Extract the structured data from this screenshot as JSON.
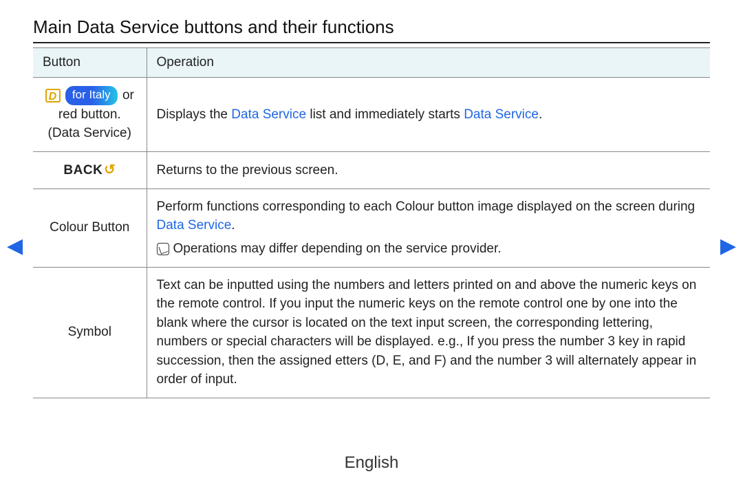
{
  "title": "Main Data Service buttons and their functions",
  "table": {
    "header": {
      "col1": "Button",
      "col2": "Operation"
    },
    "row1": {
      "button_for_italy": "for Italy",
      "button_or": " or",
      "button_line2": "red button.",
      "button_line3": "(Data Service)",
      "op_pre": "Displays the ",
      "op_link1": "Data Service",
      "op_mid": " list and immediately starts ",
      "op_link2": "Data Service",
      "op_post": "."
    },
    "row2": {
      "button_label": "BACK",
      "operation": "Returns to the previous screen."
    },
    "row3": {
      "button_label": "Colour Button",
      "op_pre": "Perform functions corresponding to each Colour button image displayed on the screen during ",
      "op_link": "Data Service",
      "op_post": ".",
      "note": "Operations may differ depending on the service provider."
    },
    "row4": {
      "button_label": "Symbol",
      "operation": "Text can be inputted using the numbers and letters printed on and above the numeric keys on the remote control. If you input the numeric keys on the remote control one by one into the blank where the cursor is located on the text input screen, the corresponding lettering, numbers or special characters will be displayed. e.g., If you press the number 3 key in rapid succession, then the assigned etters (D, E, and F) and the number 3 will alternately appear in order of input."
    }
  },
  "footer_language": "English"
}
